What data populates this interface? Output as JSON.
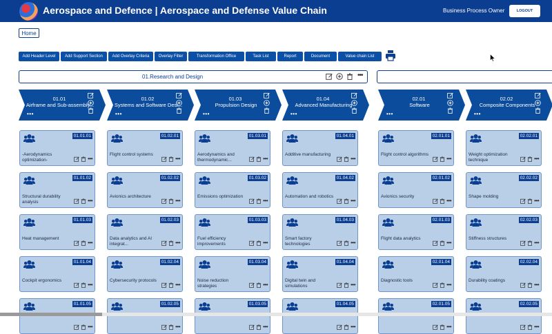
{
  "topbar": {
    "title": "Aerospace and Defence | Aerospace and Defense Value Chain",
    "role": "Business Process Owner",
    "logout": "LOGOUT"
  },
  "nav": {
    "home": "Home"
  },
  "toolbar": [
    "Add Header Level",
    "Add Support Section",
    "Add Overlay Criteria",
    "Overlay Filter",
    "Transformation Office",
    "Task List",
    "Report",
    "Document",
    "Value chain List"
  ],
  "section": {
    "title": "01.Research and Design"
  },
  "headers": [
    {
      "code": "01.01",
      "name": "Airframe and Sub-assembly..."
    },
    {
      "code": "01.02",
      "name": "Systems and Software Desi..."
    },
    {
      "code": "01.03",
      "name": "Propulsion Design"
    },
    {
      "code": "01.04",
      "name": "Advanced Manufacturing"
    },
    {
      "code": "02.01",
      "name": "Software"
    },
    {
      "code": "02.02",
      "name": "Composite Components"
    }
  ],
  "columns": [
    [
      {
        "code": "01.01.01",
        "label": "-Aerodynamics optimization-"
      },
      {
        "code": "01.01.02",
        "label": "Structural durability analysis"
      },
      {
        "code": "01.01.03",
        "label": "Heat management"
      },
      {
        "code": "01.01.04",
        "label": "Cockpit ergonomics"
      },
      {
        "code": "01.01.05",
        "label": ""
      }
    ],
    [
      {
        "code": "01.02.01",
        "label": "Flight control systems"
      },
      {
        "code": "01.02.02",
        "label": "Avionics architecture"
      },
      {
        "code": "01.02.03",
        "label": "Data analytics and AI integrat..."
      },
      {
        "code": "01.02.04",
        "label": "Cybersecurity protocols"
      },
      {
        "code": "01.02.05",
        "label": ""
      }
    ],
    [
      {
        "code": "01.03.01",
        "label": "Aerodynamics and thermodynamic..."
      },
      {
        "code": "01.03.02",
        "label": "Emissions optimization"
      },
      {
        "code": "01.03.03",
        "label": "Fuel efficiency improvements"
      },
      {
        "code": "01.03.04",
        "label": "Noise reduction strategies"
      },
      {
        "code": "01.03.05",
        "label": ""
      }
    ],
    [
      {
        "code": "01.04.01",
        "label": "Additive manufacturing"
      },
      {
        "code": "01.04.02",
        "label": "Automation and robotics"
      },
      {
        "code": "01.04.03",
        "label": "Smart factory technologies"
      },
      {
        "code": "01.04.04",
        "label": "Digital twin and simulations"
      },
      {
        "code": "01.04.05",
        "label": ""
      }
    ],
    [
      {
        "code": "02.01.01",
        "label": "Flight control algorithms"
      },
      {
        "code": "02.01.02",
        "label": "Avionics security"
      },
      {
        "code": "02.01.03",
        "label": "Flight data analytics"
      },
      {
        "code": "02.01.04",
        "label": "Diagnostic tools"
      },
      {
        "code": "02.01.05",
        "label": ""
      }
    ],
    [
      {
        "code": "02.02.01",
        "label": "Weight optimization technique"
      },
      {
        "code": "02.02.02",
        "label": "Shape molding"
      },
      {
        "code": "02.02.03",
        "label": "Stiffness structures"
      },
      {
        "code": "02.02.04",
        "label": "Durability coatings"
      },
      {
        "code": "02.02.05",
        "label": ""
      }
    ]
  ],
  "colors": {
    "primary": "#0b3d91",
    "card": "#b9cfe8",
    "button": "#0b4fa6"
  }
}
